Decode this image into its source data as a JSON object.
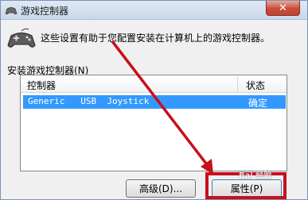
{
  "window": {
    "title": "游戏控制器",
    "close_label": "✕",
    "intro": "这些设置有助于您配置安装在计算机上的游戏控制器。",
    "group_label": "安装游戏控制器(N)"
  },
  "list": {
    "columns": {
      "controller": "控制器",
      "status": "状态"
    },
    "rows": [
      {
        "name": "Generic   USB  Joystick",
        "status": "确定"
      }
    ]
  },
  "buttons": {
    "advanced": "高级(D)...",
    "properties": "属性(P)"
  },
  "watermark": "Bai 经验",
  "colors": {
    "selection": "#3399ff",
    "annotation": "#c8101b"
  }
}
